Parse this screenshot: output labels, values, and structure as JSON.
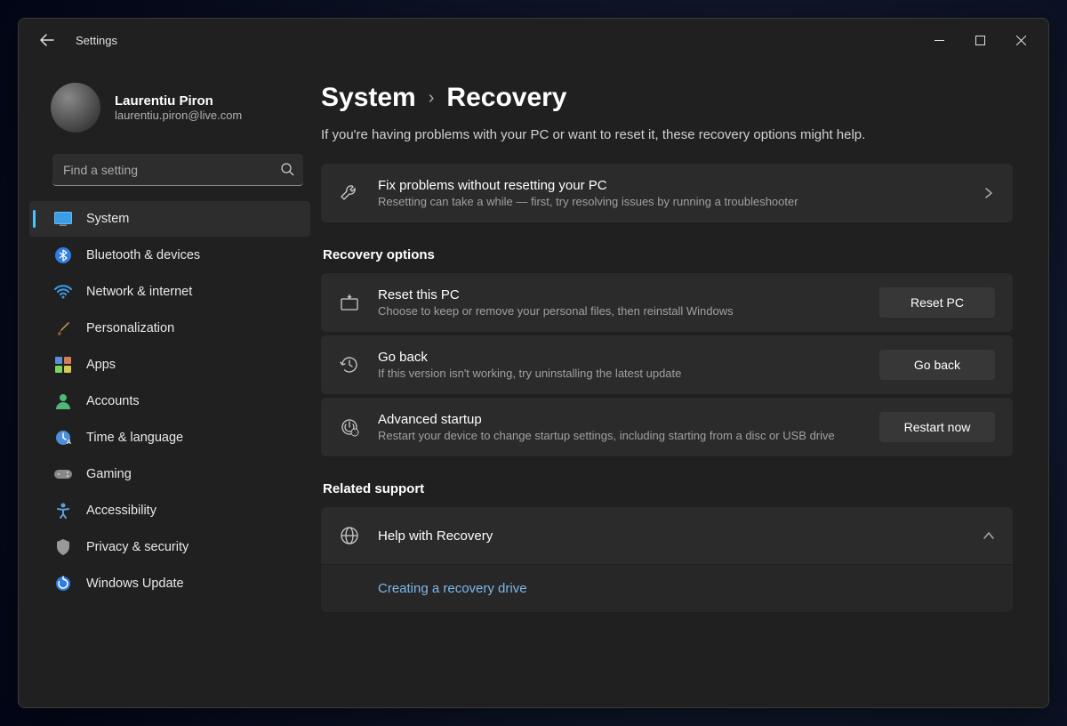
{
  "window": {
    "title": "Settings"
  },
  "user": {
    "name": "Laurentiu Piron",
    "email": "laurentiu.piron@live.com"
  },
  "search": {
    "placeholder": "Find a setting"
  },
  "nav": {
    "items": [
      {
        "label": "System",
        "icon": "system"
      },
      {
        "label": "Bluetooth & devices",
        "icon": "bluetooth"
      },
      {
        "label": "Network & internet",
        "icon": "wifi"
      },
      {
        "label": "Personalization",
        "icon": "brush"
      },
      {
        "label": "Apps",
        "icon": "apps"
      },
      {
        "label": "Accounts",
        "icon": "person"
      },
      {
        "label": "Time & language",
        "icon": "clock"
      },
      {
        "label": "Gaming",
        "icon": "gaming"
      },
      {
        "label": "Accessibility",
        "icon": "accessibility"
      },
      {
        "label": "Privacy & security",
        "icon": "shield"
      },
      {
        "label": "Windows Update",
        "icon": "update"
      }
    ],
    "active_index": 0
  },
  "breadcrumb": {
    "root": "System",
    "current": "Recovery"
  },
  "subtitle": "If you're having problems with your PC or want to reset it, these recovery options might help.",
  "fix_card": {
    "title": "Fix problems without resetting your PC",
    "desc": "Resetting can take a while — first, try resolving issues by running a troubleshooter"
  },
  "sections": {
    "recovery": {
      "heading": "Recovery options",
      "items": [
        {
          "title": "Reset this PC",
          "desc": "Choose to keep or remove your personal files, then reinstall Windows",
          "button": "Reset PC"
        },
        {
          "title": "Go back",
          "desc": "If this version isn't working, try uninstalling the latest update",
          "button": "Go back"
        },
        {
          "title": "Advanced startup",
          "desc": "Restart your device to change startup settings, including starting from a disc or USB drive",
          "button": "Restart now"
        }
      ]
    },
    "support": {
      "heading": "Related support",
      "help": {
        "title": "Help with Recovery",
        "expanded_link": "Creating a recovery drive"
      }
    }
  }
}
